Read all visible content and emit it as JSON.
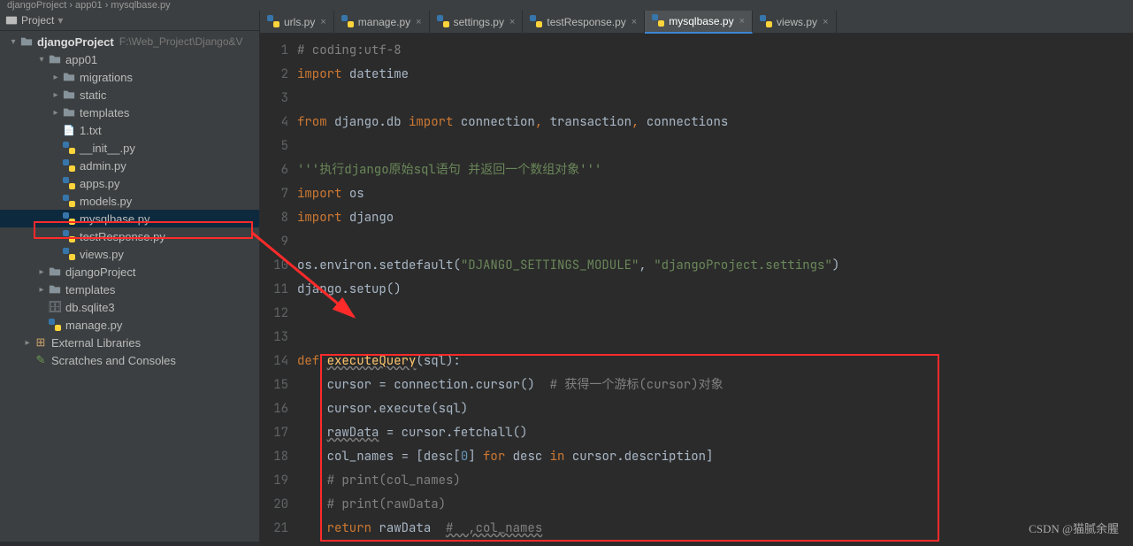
{
  "title_bar": "djangoProject › app01 › mysqlbase.py",
  "sidebar": {
    "header": "Project",
    "project_name": "djangoProject",
    "project_path": "F:\\Web_Project\\Django&V",
    "items": [
      {
        "depth": 1,
        "exp": "▾",
        "type": "folder",
        "label": "djangoProject"
      },
      {
        "depth": 2,
        "exp": "▾",
        "type": "folder",
        "label": "app01"
      },
      {
        "depth": 3,
        "exp": "▸",
        "type": "folder",
        "label": "migrations"
      },
      {
        "depth": 3,
        "exp": "▸",
        "type": "folder",
        "label": "static"
      },
      {
        "depth": 3,
        "exp": "▸",
        "type": "folder",
        "label": "templates"
      },
      {
        "depth": 3,
        "exp": " ",
        "type": "txt",
        "label": "1.txt"
      },
      {
        "depth": 3,
        "exp": " ",
        "type": "py",
        "label": "__init__.py"
      },
      {
        "depth": 3,
        "exp": " ",
        "type": "py",
        "label": "admin.py"
      },
      {
        "depth": 3,
        "exp": " ",
        "type": "py",
        "label": "apps.py"
      },
      {
        "depth": 3,
        "exp": " ",
        "type": "py",
        "label": "models.py"
      },
      {
        "depth": 3,
        "exp": " ",
        "type": "py",
        "label": "mysqlbase.py",
        "selected": true
      },
      {
        "depth": 3,
        "exp": " ",
        "type": "py",
        "label": "testResponse.py"
      },
      {
        "depth": 3,
        "exp": " ",
        "type": "py",
        "label": "views.py"
      },
      {
        "depth": 2,
        "exp": "▸",
        "type": "folder",
        "label": "djangoProject"
      },
      {
        "depth": 2,
        "exp": "▸",
        "type": "folder",
        "label": "templates"
      },
      {
        "depth": 2,
        "exp": " ",
        "type": "db",
        "label": "db.sqlite3"
      },
      {
        "depth": 2,
        "exp": " ",
        "type": "py",
        "label": "manage.py"
      },
      {
        "depth": 1,
        "exp": "▸",
        "type": "lib",
        "label": "External Libraries"
      },
      {
        "depth": 1,
        "exp": " ",
        "type": "scratch",
        "label": "Scratches and Consoles"
      }
    ]
  },
  "tabs": [
    {
      "label": "urls.py",
      "active": false
    },
    {
      "label": "manage.py",
      "active": false
    },
    {
      "label": "settings.py",
      "active": false
    },
    {
      "label": "testResponse.py",
      "active": false
    },
    {
      "label": "mysqlbase.py",
      "active": true
    },
    {
      "label": "views.py",
      "active": false
    }
  ],
  "code": {
    "lines": [
      {
        "n": 1,
        "seg": [
          {
            "c": "c-comment",
            "t": "# coding:utf-8"
          }
        ]
      },
      {
        "n": 2,
        "seg": [
          {
            "c": "c-keyword",
            "t": "import "
          },
          {
            "c": "c-plain",
            "t": "datetime"
          }
        ]
      },
      {
        "n": 3,
        "seg": []
      },
      {
        "n": 4,
        "seg": [
          {
            "c": "c-keyword",
            "t": "from "
          },
          {
            "c": "c-plain",
            "t": "django.db "
          },
          {
            "c": "c-keyword",
            "t": "import "
          },
          {
            "c": "c-plain",
            "t": "connection"
          },
          {
            "c": "c-keyword",
            "t": ", "
          },
          {
            "c": "c-plain",
            "t": "transaction"
          },
          {
            "c": "c-keyword",
            "t": ", "
          },
          {
            "c": "c-plain",
            "t": "connections"
          }
        ]
      },
      {
        "n": 5,
        "seg": []
      },
      {
        "n": 6,
        "seg": [
          {
            "c": "c-string",
            "t": "'''执行django原始sql语句 并返回一个数组对象'''"
          }
        ]
      },
      {
        "n": 7,
        "seg": [
          {
            "c": "c-keyword",
            "t": "import "
          },
          {
            "c": "c-plain",
            "t": "os"
          }
        ]
      },
      {
        "n": 8,
        "seg": [
          {
            "c": "c-keyword",
            "t": "import "
          },
          {
            "c": "c-plain",
            "t": "django"
          }
        ]
      },
      {
        "n": 9,
        "seg": []
      },
      {
        "n": 10,
        "seg": [
          {
            "c": "c-plain",
            "t": "os.environ.setdefault("
          },
          {
            "c": "c-string",
            "t": "\"DJANGO_SETTINGS_MODULE\""
          },
          {
            "c": "c-plain",
            "t": ", "
          },
          {
            "c": "c-string",
            "t": "\"djangoProject.settings\""
          },
          {
            "c": "c-plain",
            "t": ")"
          }
        ]
      },
      {
        "n": 11,
        "seg": [
          {
            "c": "c-plain",
            "t": "django.setup()"
          }
        ]
      },
      {
        "n": 12,
        "seg": []
      },
      {
        "n": 13,
        "seg": []
      },
      {
        "n": 14,
        "seg": [
          {
            "c": "c-keyword",
            "t": "def "
          },
          {
            "c": "c-func c-squiggle",
            "t": "executeQuery"
          },
          {
            "c": "c-plain",
            "t": "(sql):"
          }
        ]
      },
      {
        "n": 15,
        "seg": [
          {
            "c": "c-plain",
            "t": "    cursor = connection.cursor()  "
          },
          {
            "c": "c-comment",
            "t": "# 获得一个游标(cursor)对象"
          }
        ]
      },
      {
        "n": 16,
        "seg": [
          {
            "c": "c-plain",
            "t": "    cursor.execute(sql)"
          }
        ]
      },
      {
        "n": 17,
        "seg": [
          {
            "c": "c-plain",
            "t": "    "
          },
          {
            "c": "c-plain c-squiggle",
            "t": "rawData"
          },
          {
            "c": "c-plain",
            "t": " = cursor.fetchall()"
          }
        ]
      },
      {
        "n": 18,
        "seg": [
          {
            "c": "c-plain",
            "t": "    col_names = [desc["
          },
          {
            "c": "c-num",
            "t": "0"
          },
          {
            "c": "c-plain",
            "t": "] "
          },
          {
            "c": "c-keyword",
            "t": "for "
          },
          {
            "c": "c-plain",
            "t": "desc "
          },
          {
            "c": "c-keyword",
            "t": "in "
          },
          {
            "c": "c-plain",
            "t": "cursor.description]"
          }
        ]
      },
      {
        "n": 19,
        "seg": [
          {
            "c": "c-plain",
            "t": "    "
          },
          {
            "c": "c-comment",
            "t": "# print(col_names)"
          }
        ]
      },
      {
        "n": 20,
        "seg": [
          {
            "c": "c-plain",
            "t": "    "
          },
          {
            "c": "c-comment",
            "t": "# print(rawData)"
          }
        ]
      },
      {
        "n": 21,
        "seg": [
          {
            "c": "c-plain",
            "t": "    "
          },
          {
            "c": "c-keyword",
            "t": "return "
          },
          {
            "c": "c-plain",
            "t": "rawData  "
          },
          {
            "c": "c-comment c-squiggle",
            "t": "#  ,col_names"
          }
        ]
      }
    ]
  },
  "watermark": "CSDN @猫腻余腥"
}
